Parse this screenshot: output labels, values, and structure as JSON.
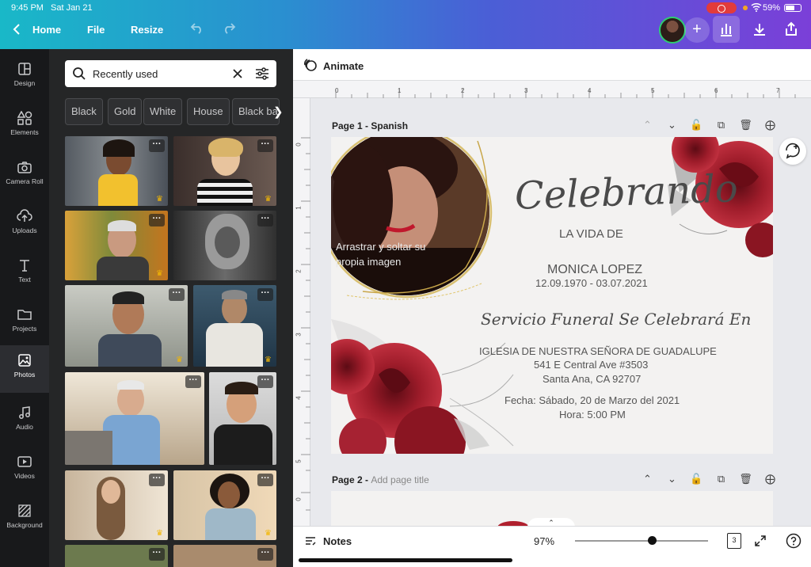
{
  "status": {
    "time": "9:45 PM",
    "date": "Sat Jan 21",
    "battery": "59%"
  },
  "topbar": {
    "home": "Home",
    "file": "File",
    "resize": "Resize"
  },
  "rail": [
    {
      "label": "Design",
      "icon": "design-icon"
    },
    {
      "label": "Elements",
      "icon": "elements-icon"
    },
    {
      "label": "Camera Roll",
      "icon": "camera-icon"
    },
    {
      "label": "Uploads",
      "icon": "upload-cloud-icon"
    },
    {
      "label": "Text",
      "icon": "text-icon"
    },
    {
      "label": "Projects",
      "icon": "folder-icon"
    },
    {
      "label": "Photos",
      "icon": "photos-icon"
    },
    {
      "label": "Audio",
      "icon": "music-note-icon"
    },
    {
      "label": "Videos",
      "icon": "video-icon"
    },
    {
      "label": "Background",
      "icon": "background-icon"
    }
  ],
  "search": {
    "value": "Recently used"
  },
  "chips": [
    "Black",
    "Gold",
    "White",
    "House",
    "Black ba"
  ],
  "animate": {
    "label": "Animate"
  },
  "ruler": {
    "h": [
      "0",
      "1",
      "2",
      "3",
      "4",
      "5",
      "6",
      "7"
    ],
    "v": [
      "0",
      "1",
      "2",
      "3",
      "4",
      "5",
      "0"
    ]
  },
  "pages": {
    "p1_title": "Page 1 - Spanish",
    "p2_title": "Page 2 - ",
    "p2_placeholder": "Add page title"
  },
  "design": {
    "photo_hint_1": "Arrastrar y soltar su",
    "photo_hint_2": "propia imagen",
    "celebrando": "Celebrando",
    "la_vida": "LA VIDA DE",
    "name": "MONICA LOPEZ",
    "dates": "12.09.1970 - 03.07.2021",
    "service": "Servicio Funeral Se Celebrará En",
    "church": "IGLESIA DE NUESTRA SEÑORA DE GUADALUPE",
    "address1": "541 E Central Ave #3503",
    "address2": "Santa Ana, CA 92707",
    "fecha": "Fecha: Sábado, 20 de Marzo del 2021",
    "hora": "Hora: 5:00 PM"
  },
  "bottombar": {
    "notes": "Notes",
    "zoom": "97%",
    "zoom_value": 0.58,
    "pages_count": "3"
  },
  "colors": {
    "accent": "#7b3fd8",
    "rose": "#9e1c2a",
    "gold": "#c9a74a"
  }
}
